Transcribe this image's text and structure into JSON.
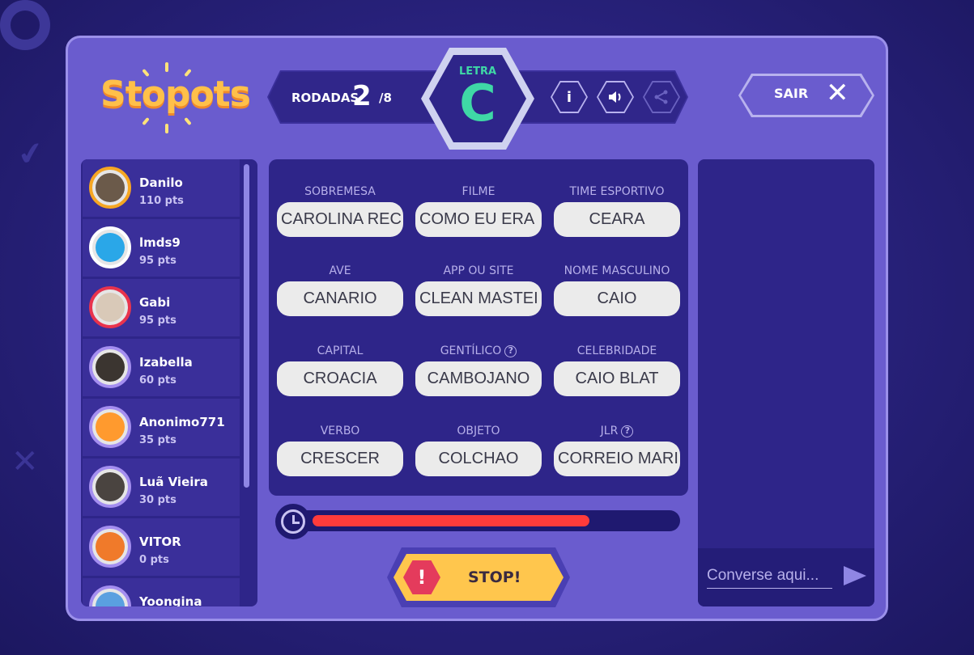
{
  "app": {
    "logo_text": "Stopots"
  },
  "header": {
    "rounds_label": "RODADAS",
    "current_round": "2",
    "total_rounds": "/8",
    "letter_label": "LETRA",
    "letter": "C",
    "exit_label": "SAIR",
    "exit_icon": "close-icon"
  },
  "players": [
    {
      "name": "Danilo",
      "points": "110 pts",
      "ring": "#f5a623"
    },
    {
      "name": "lmds9",
      "points": "95 pts",
      "ring": "#ffffff"
    },
    {
      "name": "Gabi",
      "points": "95 pts",
      "ring": "#e8334d"
    },
    {
      "name": "Izabella",
      "points": "60 pts",
      "ring": "#a48ef0"
    },
    {
      "name": "Anonimo771",
      "points": "35 pts",
      "ring": "#a48ef0"
    },
    {
      "name": "Luã Vieira",
      "points": "30 pts",
      "ring": "#a48ef0"
    },
    {
      "name": "VITOR",
      "points": "0 pts",
      "ring": "#a48ef0"
    },
    {
      "name": "Yoongina",
      "points": "",
      "ring": "#a48ef0"
    }
  ],
  "categories": [
    {
      "label": "SOBREMESA",
      "value": "CAROLINA REC",
      "help": false
    },
    {
      "label": "FILME",
      "value": "COMO EU ERA",
      "help": false
    },
    {
      "label": "TIME ESPORTIVO",
      "value": "CEARA",
      "help": false
    },
    {
      "label": "AVE",
      "value": "CANARIO",
      "help": false
    },
    {
      "label": "APP OU SITE",
      "value": "CLEAN MASTEI",
      "help": false
    },
    {
      "label": "NOME MASCULINO",
      "value": "CAIO",
      "help": false
    },
    {
      "label": "CAPITAL",
      "value": "CROACIA",
      "help": false
    },
    {
      "label": "GENTÍLICO",
      "value": "CAMBOJANO",
      "help": true
    },
    {
      "label": "CELEBRIDADE",
      "value": "CAIO BLAT",
      "help": false
    },
    {
      "label": "VERBO",
      "value": "CRESCER",
      "help": false
    },
    {
      "label": "OBJETO",
      "value": "COLCHAO",
      "help": false
    },
    {
      "label": "JLR",
      "value": "CORREIO MARI",
      "help": true
    }
  ],
  "timer": {
    "remaining_fraction": 0.77
  },
  "stop_button": {
    "label": "STOP!",
    "icon": "alert-icon"
  },
  "chat": {
    "placeholder": "Converse aqui...",
    "send_icon": "send-icon"
  },
  "colors": {
    "panel": "#6a5cce",
    "dark_panel": "#2e2589",
    "letter_accent": "#3fd8a6",
    "timer_fill": "#ff3b3b",
    "stop_button": "#ffc64d",
    "logo": "#ffc04a"
  }
}
